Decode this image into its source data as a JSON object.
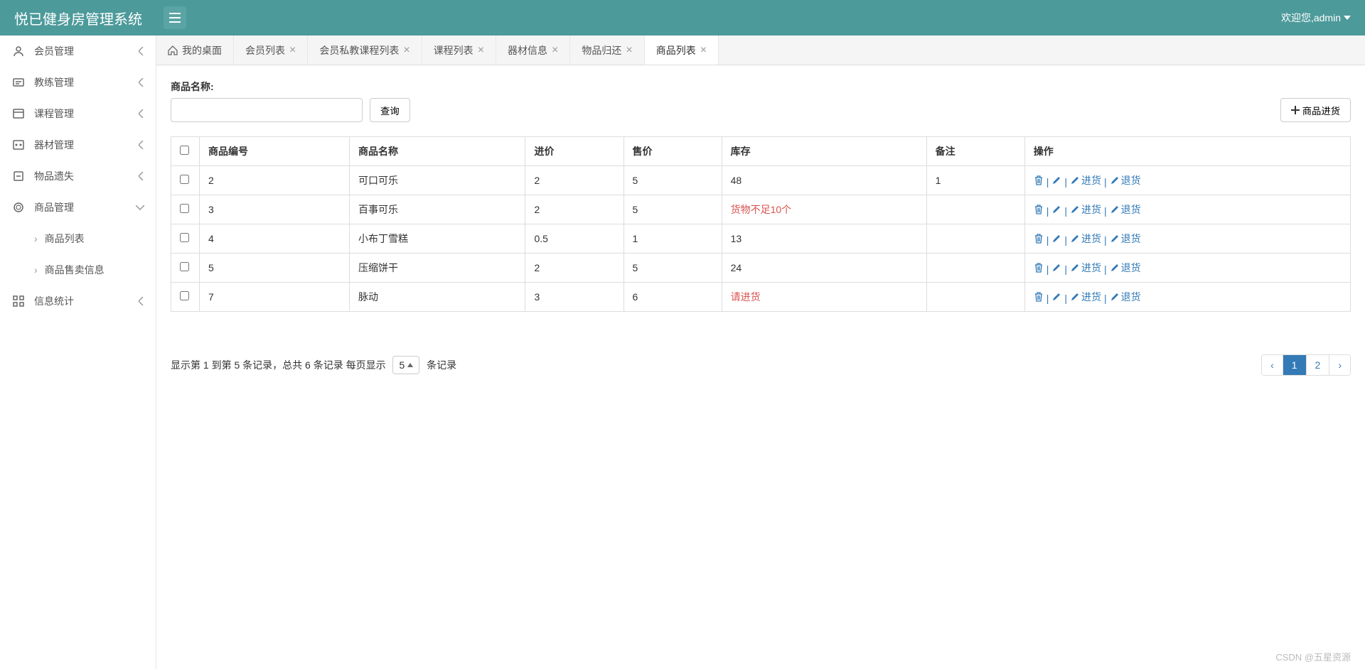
{
  "header": {
    "title": "悦已健身房管理系统",
    "welcome": "欢迎您,admin"
  },
  "sidebar": {
    "items": [
      {
        "label": "会员管理",
        "icon": "user"
      },
      {
        "label": "教练管理",
        "icon": "coach"
      },
      {
        "label": "课程管理",
        "icon": "course"
      },
      {
        "label": "器材管理",
        "icon": "equipment"
      },
      {
        "label": "物品遗失",
        "icon": "lost"
      },
      {
        "label": "商品管理",
        "icon": "product",
        "expanded": true
      },
      {
        "label": "信息统计",
        "icon": "stats"
      }
    ],
    "sub": [
      {
        "label": "商品列表"
      },
      {
        "label": "商品售卖信息"
      }
    ]
  },
  "tabs": [
    {
      "label": "我的桌面",
      "home": true
    },
    {
      "label": "会员列表"
    },
    {
      "label": "会员私教课程列表"
    },
    {
      "label": "课程列表"
    },
    {
      "label": "器材信息"
    },
    {
      "label": "物品归还"
    },
    {
      "label": "商品列表",
      "active": true
    }
  ],
  "search": {
    "label": "商品名称:",
    "value": "",
    "query_btn": "查询",
    "stock_btn": "商品进货"
  },
  "table": {
    "headers": [
      "商品编号",
      "商品名称",
      "进价",
      "售价",
      "库存",
      "备注",
      "操作"
    ],
    "rows": [
      {
        "id": "2",
        "name": "可口可乐",
        "cost": "2",
        "price": "5",
        "stock": "48",
        "stock_warn": false,
        "remark": "1"
      },
      {
        "id": "3",
        "name": "百事可乐",
        "cost": "2",
        "price": "5",
        "stock": "货物不足10个",
        "stock_warn": true,
        "remark": ""
      },
      {
        "id": "4",
        "name": "小布丁雪糕",
        "cost": "0.5",
        "price": "1",
        "stock": "13",
        "stock_warn": false,
        "remark": ""
      },
      {
        "id": "5",
        "name": "压缩饼干",
        "cost": "2",
        "price": "5",
        "stock": "24",
        "stock_warn": false,
        "remark": ""
      },
      {
        "id": "7",
        "name": "脉动",
        "cost": "3",
        "price": "6",
        "stock": "请进货",
        "stock_warn": true,
        "remark": ""
      }
    ],
    "actions": {
      "restock": "进货",
      "return": "退货"
    }
  },
  "footer": {
    "info_prefix": "显示第 1 到第 5 条记录，总共 6 条记录 每页显示",
    "page_size": "5",
    "info_suffix": "条记录",
    "pages": [
      "‹",
      "1",
      "2",
      "›"
    ],
    "active_page": "1"
  },
  "watermark": "CSDN @五星资源"
}
